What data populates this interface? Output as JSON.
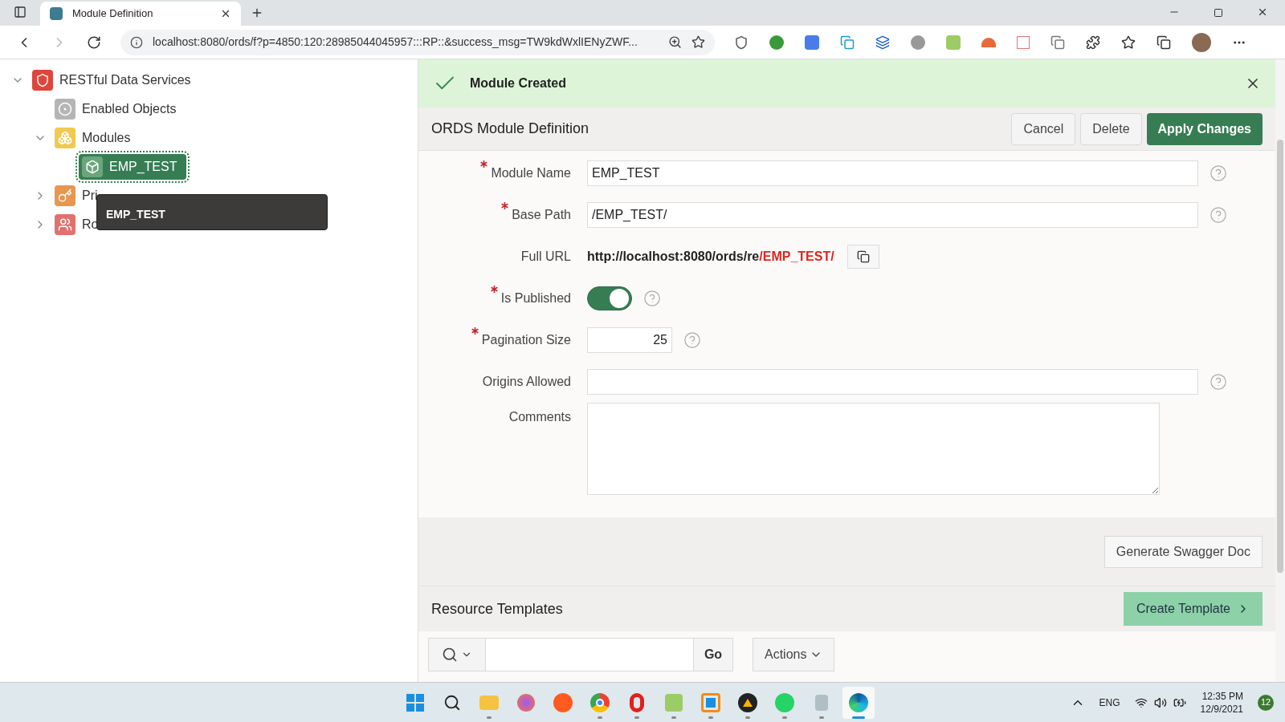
{
  "browser": {
    "tab_title": "Module Definition",
    "address": "localhost:8080/ords/f?p=4850:120:28985044045957:::RP::&success_msg=TW9kdWxlIENyZWF..."
  },
  "tree": {
    "label": "RESTful Data Services",
    "kind": "shield",
    "expanded": true,
    "children": [
      {
        "label": "Enabled Objects",
        "kind": "objects",
        "selected": false
      },
      {
        "label": "Modules",
        "kind": "modules",
        "expanded": true,
        "selected": false,
        "children": [
          {
            "label": "EMP_TEST",
            "kind": "cube",
            "selected": true
          }
        ]
      },
      {
        "label": "Pri",
        "kind": "key",
        "expanded": false,
        "selected": false
      },
      {
        "label": "Ro",
        "kind": "people",
        "expanded": false,
        "selected": false
      }
    ]
  },
  "tooltip": "EMP_TEST",
  "alert": {
    "text": "Module Created"
  },
  "region": {
    "title": "ORDS Module Definition",
    "buttons": [
      {
        "label": "Cancel",
        "kind": "default"
      },
      {
        "label": "Delete",
        "kind": "default"
      },
      {
        "label": "Apply Changes",
        "kind": "primary"
      }
    ]
  },
  "fields": [
    {
      "kind": "text",
      "label": "Module Name",
      "required": true,
      "value": "EMP_TEST",
      "help": true
    },
    {
      "kind": "text",
      "label": "Base Path",
      "required": true,
      "value": "/EMP_TEST/",
      "help": true
    },
    {
      "kind": "url",
      "label": "Full URL",
      "required": false,
      "base": "http://localhost:8080/ords/re",
      "path": "/EMP_TEST/",
      "help": false
    },
    {
      "kind": "switch",
      "label": "Is Published",
      "required": true,
      "on": true,
      "help": true
    },
    {
      "kind": "number",
      "label": "Pagination Size",
      "required": true,
      "value": "25",
      "help": true
    },
    {
      "kind": "text",
      "label": "Origins Allowed",
      "required": false,
      "help": true
    },
    {
      "kind": "textarea",
      "label": "Comments",
      "required": false,
      "help": false
    }
  ],
  "swagger_button": "Generate Swagger Doc",
  "templates": {
    "title": "Resource Templates",
    "create_button": "Create Template",
    "go_button": "Go",
    "actions_button": "Actions"
  },
  "taskbar": {
    "apps": [
      {
        "kind": "start",
        "running": false,
        "active": false
      },
      {
        "kind": "search",
        "running": false,
        "active": false
      },
      {
        "kind": "folder",
        "running": true,
        "active": false
      },
      {
        "kind": "firefox",
        "running": false,
        "active": false
      },
      {
        "kind": "cloud",
        "running": false,
        "active": false
      },
      {
        "kind": "chrome",
        "running": true,
        "active": false
      },
      {
        "kind": "opera",
        "running": true,
        "active": false
      },
      {
        "kind": "editor",
        "running": true,
        "active": false
      },
      {
        "kind": "windows",
        "running": true,
        "active": false
      },
      {
        "kind": "triangle",
        "running": true,
        "active": false
      },
      {
        "kind": "chat",
        "running": true,
        "active": false
      },
      {
        "kind": "media",
        "running": true,
        "active": false
      },
      {
        "kind": "edge",
        "running": true,
        "active": true
      }
    ],
    "language": "ENG",
    "time": "12:35 PM",
    "date": "12/9/2021",
    "notifications": "12"
  }
}
